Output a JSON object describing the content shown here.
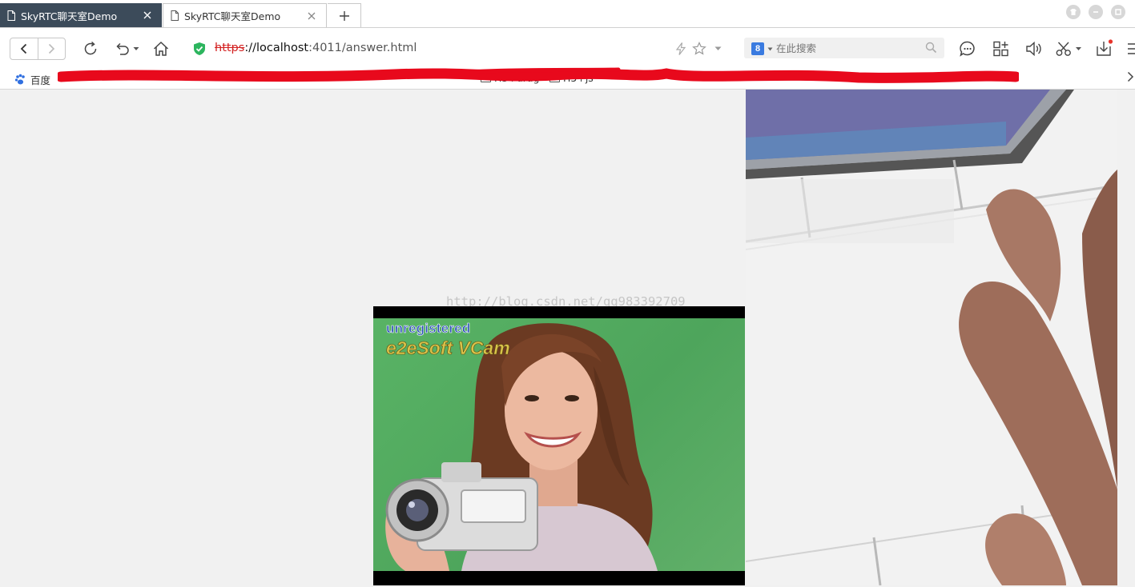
{
  "tabs": [
    {
      "title": "SkyRTC聊天室Demo",
      "active": true
    },
    {
      "title": "SkyRTC聊天室Demo",
      "active": false
    }
  ],
  "toolbar": {
    "url_scheme": "https",
    "url_host": "://localhost",
    "url_rest": ":4011/answer.html"
  },
  "search": {
    "engine_label": "8",
    "placeholder": "在此搜索"
  },
  "bookmarks": [
    {
      "label": "百度"
    },
    {
      "label": "H5+drag"
    },
    {
      "label": "H5+js"
    }
  ],
  "page": {
    "watermark": "http://blog.csdn.net/qq983392709"
  },
  "local_video": {
    "overlay_line1": "unregistered",
    "overlay_line2": "e2eSoft VCam"
  },
  "colors": {
    "active_tab_bg": "#3c4b5a",
    "secure_shield": "#2cb55e",
    "url_https_strike": "#d32020",
    "redaction_scribble": "#e8091c",
    "green_screen": "#53aa60"
  },
  "icons": {
    "secure": "shield-check-icon",
    "search": "magnifier-icon",
    "bookmark_baidu": "paw-icon"
  }
}
